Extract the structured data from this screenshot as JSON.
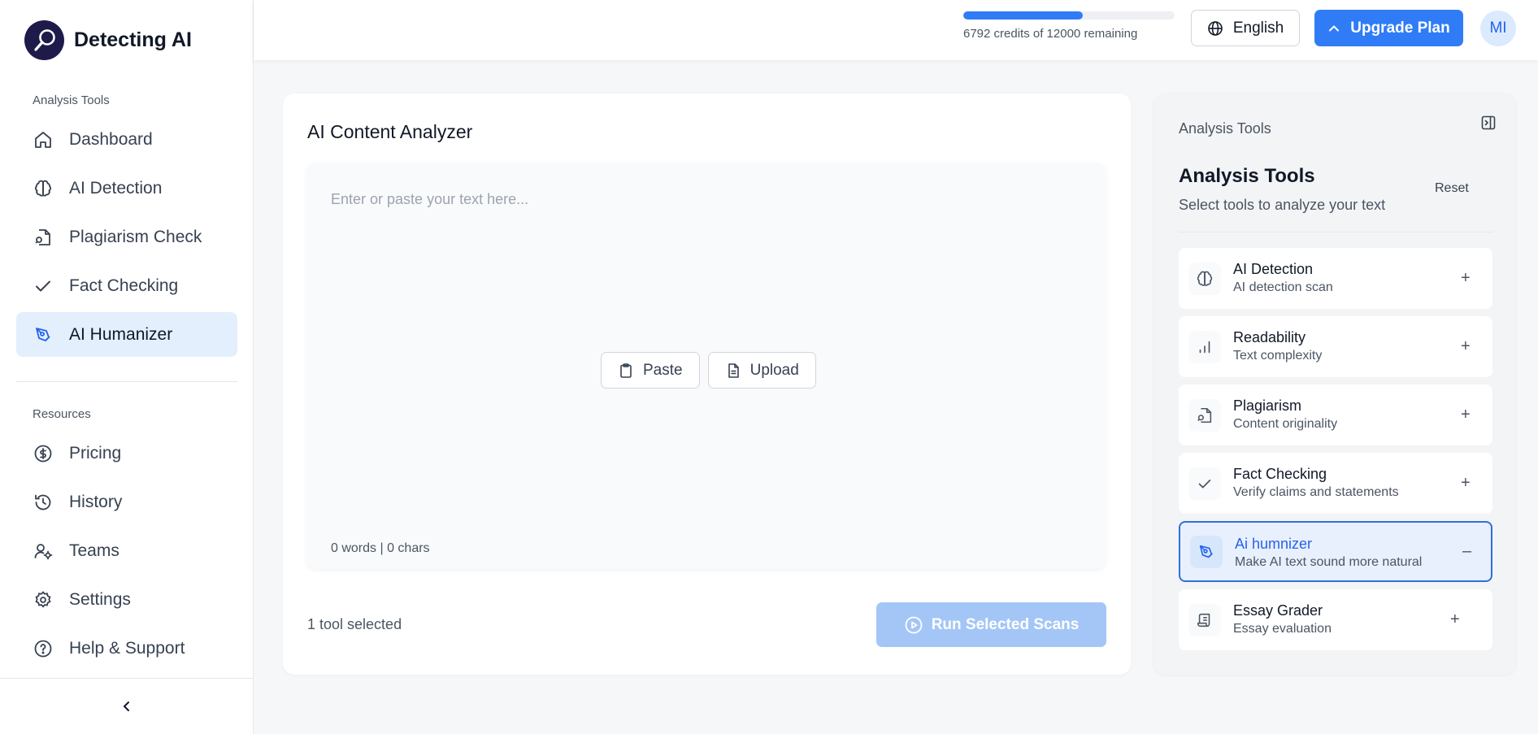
{
  "brand": {
    "name": "Detecting AI"
  },
  "sidebar": {
    "sections": [
      {
        "label": "Analysis Tools"
      },
      {
        "label": "Resources"
      }
    ],
    "analysis_items": [
      {
        "label": "Dashboard",
        "icon": "home-icon"
      },
      {
        "label": "AI Detection",
        "icon": "brain-icon"
      },
      {
        "label": "Plagiarism Check",
        "icon": "file-search-icon"
      },
      {
        "label": "Fact Checking",
        "icon": "check-icon"
      },
      {
        "label": "AI Humanizer",
        "icon": "pen-tool-icon",
        "active": true
      }
    ],
    "resource_items": [
      {
        "label": "Pricing",
        "icon": "dollar-circle-icon"
      },
      {
        "label": "History",
        "icon": "history-icon"
      },
      {
        "label": "Teams",
        "icon": "user-gear-icon"
      },
      {
        "label": "Settings",
        "icon": "gear-icon"
      },
      {
        "label": "Help & Support",
        "icon": "help-circle-icon"
      }
    ]
  },
  "header": {
    "credits_text": "6792 credits of 12000 remaining",
    "credits_used_fraction": 0.566,
    "language": "English",
    "upgrade_label": "Upgrade Plan",
    "avatar_initials": "MI"
  },
  "main": {
    "title": "AI Content Analyzer",
    "placeholder": "Enter or paste your text here...",
    "paste_label": "Paste",
    "upload_label": "Upload",
    "counts": "0 words | 0 chars",
    "tools_selected": "1 tool selected",
    "run_label": "Run Selected Scans"
  },
  "panel": {
    "eyebrow": "Analysis Tools",
    "title": "Analysis Tools",
    "reset_label": "Reset",
    "subtitle": "Select tools to analyze your text",
    "tools": [
      {
        "name": "AI Detection",
        "desc": "AI detection scan",
        "icon": "brain-icon",
        "toggle": "+"
      },
      {
        "name": "Readability",
        "desc": "Text complexity",
        "icon": "bar-chart-icon",
        "toggle": "+"
      },
      {
        "name": "Plagiarism",
        "desc": "Content originality",
        "icon": "file-search-icon",
        "toggle": "+"
      },
      {
        "name": "Fact Checking",
        "desc": "Verify claims and statements",
        "icon": "check-icon",
        "toggle": "+"
      },
      {
        "name": "Ai humnizer",
        "desc": "Make AI text sound more natural",
        "icon": "pen-tool-icon",
        "toggle": "–",
        "selected": true
      },
      {
        "name": "Essay Grader",
        "desc": "Essay evaluation",
        "icon": "scroll-icon",
        "toggle": "+"
      }
    ]
  },
  "colors": {
    "accent": "#2f7cf6",
    "active_bg": "#e3effd",
    "run_disabled": "#a4c6f6"
  }
}
